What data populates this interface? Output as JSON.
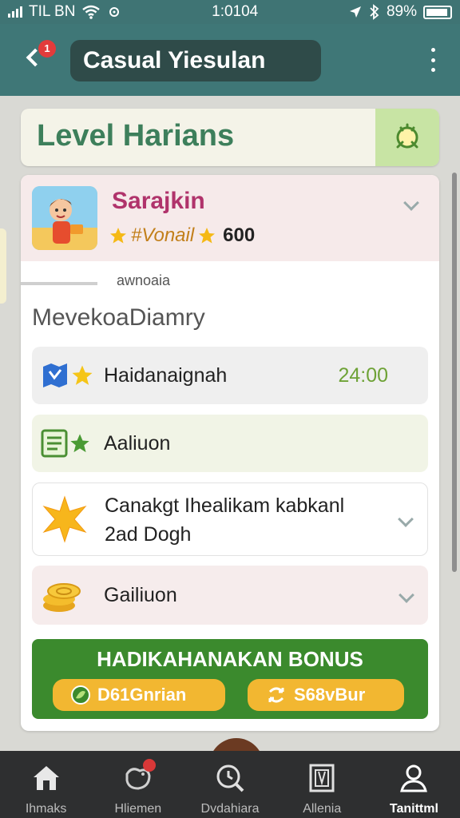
{
  "status_bar": {
    "carrier": "TIL BN",
    "time": "1:0104",
    "battery": "89%"
  },
  "app_bar": {
    "title": "Casual Yiesulan",
    "back_badge": "1"
  },
  "level_card": {
    "title": "Level Harians"
  },
  "profile": {
    "name": "Sarajkin",
    "rank_label": "#Vonail",
    "score": "600"
  },
  "caption": "awnoaia",
  "section_title": "MevekoaDiamry",
  "missions": [
    {
      "icon": "map-star-icon",
      "label": "Haidanaignah",
      "value": "24:00"
    },
    {
      "icon": "list-star-icon",
      "label": "Aaliuon",
      "value": ""
    },
    {
      "icon": "starburst-icon",
      "label": "Canakgt Ihealikam kabkanl\n2ad Dogh",
      "value": ""
    },
    {
      "icon": "coins-icon",
      "label": "Gailiuon",
      "value": ""
    }
  ],
  "bonus": {
    "title": "HADIKAHANAKAN BONUS",
    "left_button": "D61Gnrian",
    "right_button": "S68vBur"
  },
  "bottom_nav": [
    {
      "label": "Ihmaks",
      "icon": "home-icon"
    },
    {
      "label": "Hliemen",
      "icon": "bird-icon"
    },
    {
      "label": "Dvdahiara",
      "icon": "search-icon"
    },
    {
      "label": "Allenia",
      "icon": "book-icon"
    },
    {
      "label": "Tanittml",
      "icon": "profile-icon"
    }
  ],
  "colors": {
    "app_bar": "#3f7777",
    "title_pill": "#2f4b49",
    "level_title": "#3d7f5b",
    "profile_name": "#b0336b",
    "bonus_bg": "#3b8a2d",
    "bonus_button": "#f2b731",
    "bottom_nav": "#2e2f30"
  }
}
